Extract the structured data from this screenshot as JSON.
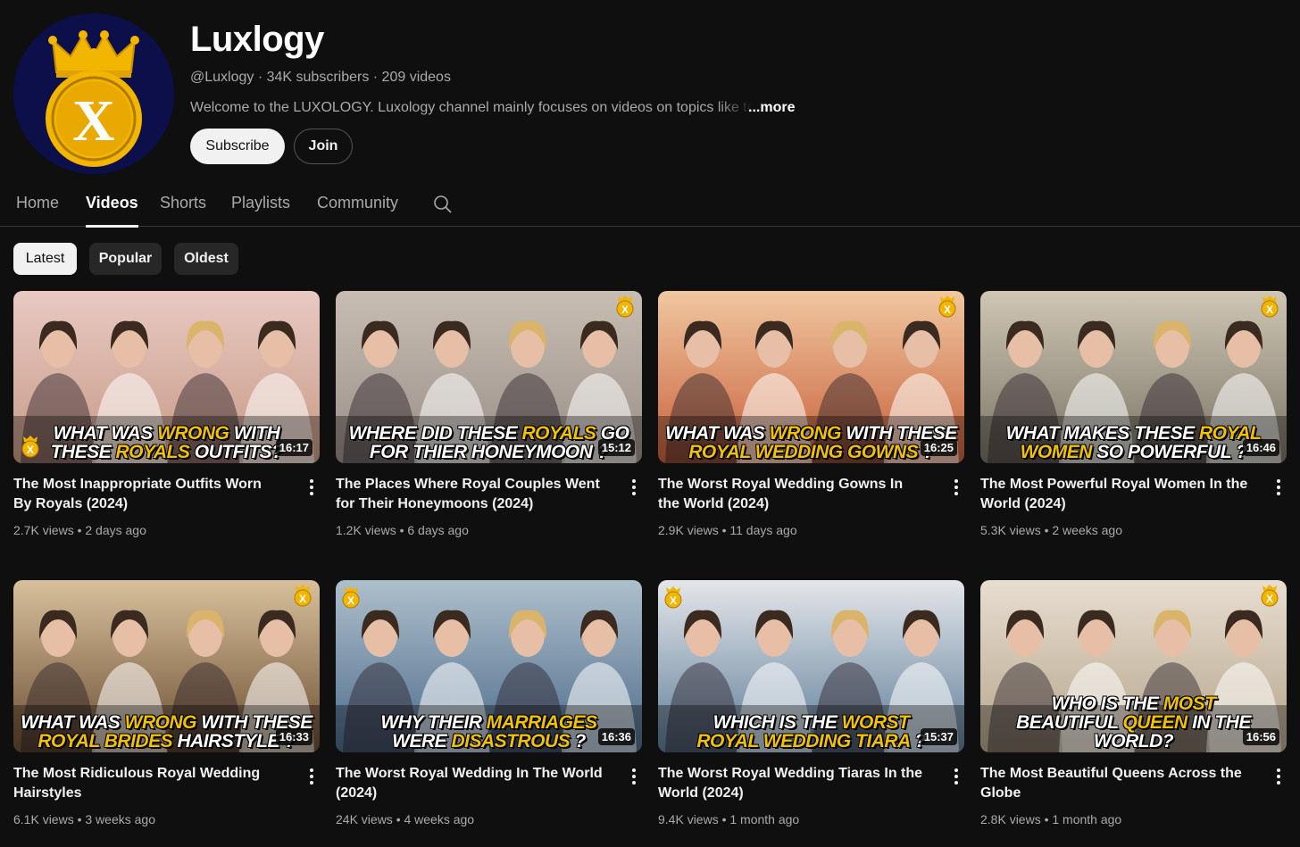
{
  "channel": {
    "name": "Luxlogy",
    "meta": "@Luxlogy · 34K subscribers · 209 videos",
    "description": "Welcome to the LUXOLOGY. Luxology channel mainly focuses on videos on topics like top",
    "more_label": "...more",
    "subscribe_label": "Subscribe",
    "join_label": "Join",
    "avatar_letter": "X"
  },
  "tabs": [
    {
      "label": "Home",
      "active": false
    },
    {
      "label": "Videos",
      "active": true
    },
    {
      "label": "Shorts",
      "active": false
    },
    {
      "label": "Playlists",
      "active": false
    },
    {
      "label": "Community",
      "active": false
    }
  ],
  "chips": [
    {
      "label": "Latest",
      "active": true
    },
    {
      "label": "Popular",
      "active": false
    },
    {
      "label": "Oldest",
      "active": false
    }
  ],
  "badge_letter": "X",
  "videos": [
    {
      "title": "The Most Inappropriate Outfits Worn By Royals (2024)",
      "meta": "2.7K views • 2 days ago",
      "duration": "16:17",
      "caption1": "WHAT WAS WRONG WITH",
      "caption2": "THESE ROYALS OUTFITS?",
      "colors": [
        "#c89a86",
        "#e8c9c2"
      ]
    },
    {
      "title": "The Places Where Royal Couples Went for Their Honeymoons (2024)",
      "meta": "1.2K views • 6 days ago",
      "duration": "15:12",
      "caption1": "WHERE DID THESE ROYALS GO",
      "caption2": "FOR THIER HONEYMOON ?",
      "colors": [
        "#9a8f88",
        "#c7bdb2"
      ]
    },
    {
      "title": "The Worst Royal Wedding Gowns In the World (2024)",
      "meta": "2.9K views • 11 days ago",
      "duration": "16:25",
      "caption1": "WHAT WAS WRONG WITH THESE",
      "caption2": "ROYAL WEDDING GOWNS ?",
      "colors": [
        "#c8603a",
        "#f0c7a0"
      ]
    },
    {
      "title": "The Most Powerful Royal Women In the World (2024)",
      "meta": "5.3K views • 2 weeks ago",
      "duration": "16:46",
      "caption1": "WHAT MAKES THESE ROYAL",
      "caption2": "WOMEN SO POWERFUL ?",
      "colors": [
        "#7a7466",
        "#cfc6b4"
      ]
    },
    {
      "title": "The Most Ridiculous Royal Wedding Hairstyles",
      "meta": "6.1K views • 3 weeks ago",
      "duration": "16:33",
      "caption1": "WHAT WAS WRONG WITH THESE",
      "caption2": "ROYAL BRIDES HAIRSTYLE ?",
      "colors": [
        "#6b4e32",
        "#d8c09c"
      ]
    },
    {
      "title": "The Worst Royal Wedding In The World (2024)",
      "meta": "24K views • 4 weeks ago",
      "duration": "16:36",
      "caption1": "WHY THEIR MARRIAGES",
      "caption2": "WERE DISASTROUS ?",
      "colors": [
        "#4c6b8a",
        "#aebfcc"
      ]
    },
    {
      "title": "The Worst Royal Wedding Tiaras In the World (2024)",
      "meta": "9.4K views • 1 month ago",
      "duration": "15:37",
      "caption1": "WHICH IS THE WORST",
      "caption2": "ROYAL WEDDING TIARA ?",
      "colors": [
        "#5e7d98",
        "#e4e6ea"
      ]
    },
    {
      "title": "The Most Beautiful Queens Across the Globe",
      "meta": "2.8K views • 1 month ago",
      "duration": "16:56",
      "caption1": "WHO IS THE MOST",
      "caption2": "BEAUTIFUL QUEEN IN THE WORLD?",
      "colors": [
        "#b4a58a",
        "#e8ddd0"
      ]
    }
  ],
  "theme": {
    "accent_yellow": "#f2c200",
    "background": "#0f0f0f"
  }
}
